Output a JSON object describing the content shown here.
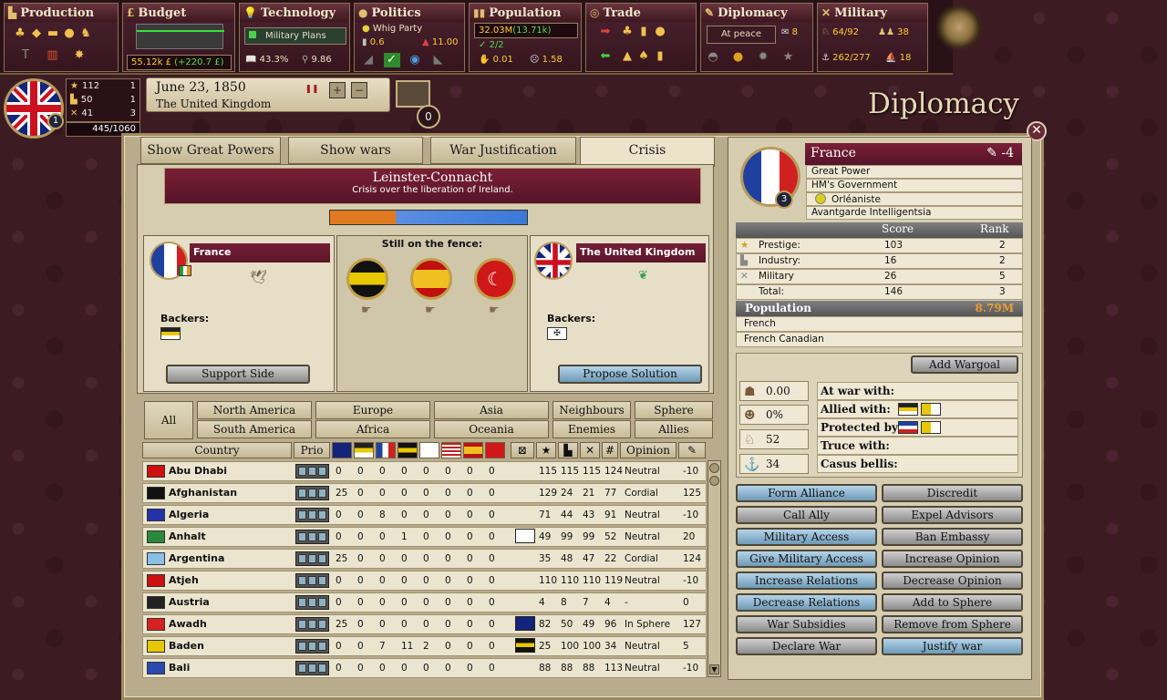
{
  "topbar": {
    "production": {
      "title": "Production"
    },
    "budget": {
      "title": "Budget",
      "funds": "55.12k £",
      "delta": "(+220.7 £)"
    },
    "technology": {
      "title": "Technology",
      "research": "Military Plans",
      "literacy": "43.3%",
      "rp": "9.86"
    },
    "politics": {
      "title": "Politics",
      "party": "Whig Party",
      "plurality": "0.6",
      "revanchism": "11.00"
    },
    "population": {
      "title": "Population",
      "total": "32.03M",
      "growth": "(13.71k)",
      "militancy_fraction": "2/2",
      "consciousness": "0.01",
      "pop_other": "1.58"
    },
    "trade": {
      "title": "Trade"
    },
    "diplomacy": {
      "title": "Diplomacy",
      "status": "At peace",
      "points": "8"
    },
    "military": {
      "title": "Military",
      "brigades": "64/92",
      "units": "38",
      "navy": "262/277",
      "ships": "18"
    }
  },
  "nation": {
    "rank": "1",
    "prestige": "112",
    "prestige_rank": "1",
    "industry": "50",
    "industry_rank": "1",
    "military": "41",
    "military_rank": "3",
    "score": "445/1060"
  },
  "date": "June 23, 1850",
  "player_country": "The United Kingdom",
  "messages": "0",
  "window_title": "Diplomacy",
  "tabs": [
    "Show Great Powers",
    "Show wars",
    "War Justification",
    "Crisis"
  ],
  "crisis": {
    "title": "Leinster-Connacht",
    "description": "Crisis over the liberation of Ireland.",
    "attacker_share": 0.33,
    "attacker": {
      "name": "France",
      "backers_label": "Backers:",
      "button": "Support Side"
    },
    "fence_title": "Still on the fence:",
    "defender": {
      "name": "The United Kingdom",
      "backers_label": "Backers:",
      "button": "Propose Solution"
    }
  },
  "filters": {
    "all": "All",
    "items": [
      "North America",
      "Europe",
      "Asia",
      "Neighbours",
      "Sphere",
      "South America",
      "Africa",
      "Oceania",
      "Enemies",
      "Allies"
    ]
  },
  "table": {
    "headers": {
      "country": "Country",
      "prio": "Prio",
      "opinion": "Opinion"
    },
    "rows": [
      {
        "name": "Abu Dhabi",
        "flag": "#cc1010",
        "v": [
          "0",
          "0",
          "0",
          "0",
          "0",
          "0",
          "0",
          "0"
        ],
        "s": [
          "115",
          "115",
          "115",
          "124"
        ],
        "opinion": "Neutral",
        "rel": "-10"
      },
      {
        "name": "Afghanistan",
        "flag": "#111111",
        "v": [
          "25",
          "0",
          "0",
          "0",
          "0",
          "0",
          "0",
          "0"
        ],
        "s": [
          "129",
          "24",
          "21",
          "77"
        ],
        "opinion": "Cordial",
        "rel": "125"
      },
      {
        "name": "Algeria",
        "flag": "#2233aa",
        "v": [
          "0",
          "0",
          "8",
          "0",
          "0",
          "0",
          "0",
          "0"
        ],
        "s": [
          "71",
          "44",
          "43",
          "91"
        ],
        "opinion": "Neutral",
        "rel": "-10"
      },
      {
        "name": "Anhalt",
        "flag": "#2a8a3a",
        "v": [
          "0",
          "0",
          "0",
          "1",
          "0",
          "0",
          "0",
          "0"
        ],
        "s": [
          "49",
          "99",
          "99",
          "52"
        ],
        "opinion": "Neutral",
        "rel": "20"
      },
      {
        "name": "Argentina",
        "flag": "#8ac0e8",
        "v": [
          "25",
          "0",
          "0",
          "0",
          "0",
          "0",
          "0",
          "0"
        ],
        "s": [
          "35",
          "48",
          "47",
          "22"
        ],
        "opinion": "Cordial",
        "rel": "124"
      },
      {
        "name": "Atjeh",
        "flag": "#cc1010",
        "v": [
          "0",
          "0",
          "0",
          "0",
          "0",
          "0",
          "0",
          "0"
        ],
        "s": [
          "110",
          "110",
          "110",
          "119"
        ],
        "opinion": "Neutral",
        "rel": "-10"
      },
      {
        "name": "Austria",
        "flag": "#222222",
        "v": [
          "0",
          "0",
          "0",
          "0",
          "0",
          "0",
          "0",
          "0"
        ],
        "s": [
          "4",
          "8",
          "7",
          "4"
        ],
        "opinion": "-",
        "rel": "0"
      },
      {
        "name": "Awadh",
        "flag": "#d82020",
        "v": [
          "25",
          "0",
          "0",
          "0",
          "0",
          "0",
          "0",
          "0"
        ],
        "s": [
          "82",
          "50",
          "49",
          "96"
        ],
        "opinion": "In Sphere",
        "rel": "127"
      },
      {
        "name": "Baden",
        "flag": "#e8c800",
        "v": [
          "0",
          "0",
          "7",
          "11",
          "2",
          "0",
          "0",
          "0"
        ],
        "s": [
          "25",
          "100",
          "100",
          "34"
        ],
        "opinion": "Neutral",
        "rel": "5"
      },
      {
        "name": "Bali",
        "flag": "#2a4ab0",
        "v": [
          "0",
          "0",
          "0",
          "0",
          "0",
          "0",
          "0",
          "0"
        ],
        "s": [
          "88",
          "88",
          "88",
          "113"
        ],
        "opinion": "Neutral",
        "rel": "-10"
      }
    ]
  },
  "target": {
    "name": "France",
    "relations": "-4",
    "rank": "3",
    "status": "Great Power",
    "government": "HM's Government",
    "party": "Orléaniste",
    "ideology": "Avantgarde Intelligentsia",
    "score_header": "Score",
    "rank_header": "Rank",
    "prestige_label": "Prestige:",
    "prestige": "103",
    "prestige_rank": "2",
    "industry_label": "Industry:",
    "industry": "16",
    "industry_rank": "2",
    "military_label": "Military",
    "military": "26",
    "military_rank": "5",
    "total_label": "Total:",
    "total": "146",
    "total_rank": "3",
    "population_label": "Population",
    "population": "8.79M",
    "cultures": [
      "French",
      "French Canadian"
    ],
    "add_wargoal": "Add Wargoal",
    "infamy": "0.00",
    "war_exhaustion": "0%",
    "brigades": "52",
    "ships": "34",
    "at_war_label": "At war with:",
    "allied_label": "Allied with:",
    "protected_label": "Protected by:",
    "truce_label": "Truce with:",
    "cb_label": "Casus bellis:"
  },
  "actions": [
    "Form Alliance",
    "Discredit",
    "Call Ally",
    "Expel Advisors",
    "Military Access",
    "Ban Embassy",
    "Give Military Access",
    "Increase Opinion",
    "Increase Relations",
    "Decrease Opinion",
    "Decrease Relations",
    "Add to Sphere",
    "War Subsidies",
    "Remove from Sphere",
    "Declare War",
    "Justify war"
  ],
  "colors": {
    "crisis_red": "#6a1a30",
    "button_blue": "#8fb8d6",
    "button_gray": "#aaaaaa",
    "highlight_gold": "#e8a030"
  }
}
